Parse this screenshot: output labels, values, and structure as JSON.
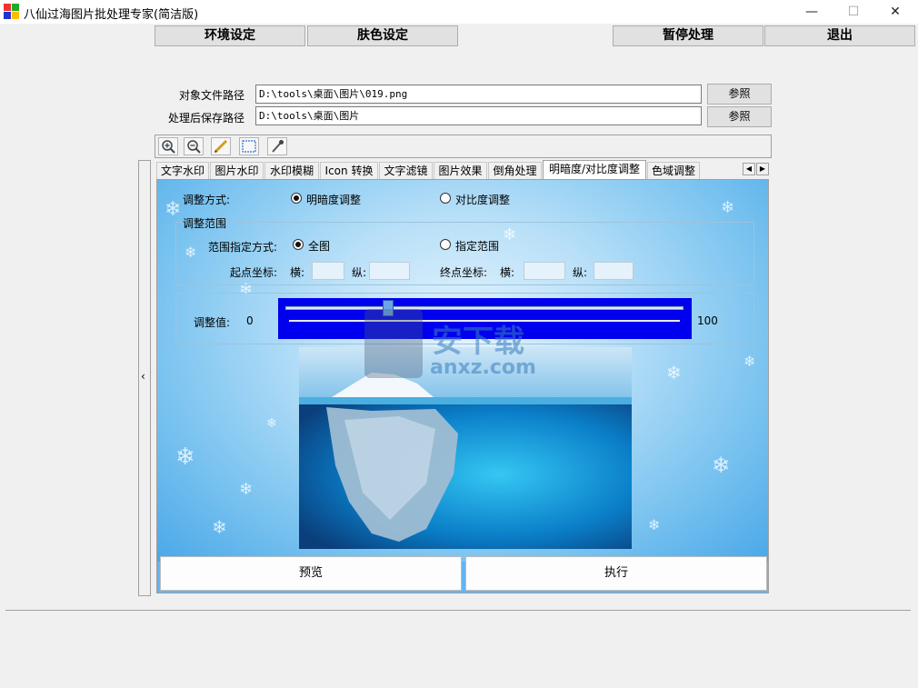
{
  "window": {
    "title": "八仙过海图片批处理专家(简洁版)",
    "minimize": "—",
    "maximize": "☐",
    "close": "✕"
  },
  "toolbar": {
    "env_settings": "环境设定",
    "skin_settings": "肤色设定",
    "pause": "暂停处理",
    "exit": "退出"
  },
  "paths": {
    "source_label": "对象文件路径",
    "source_value": "D:\\tools\\桌面\\图片\\019.png",
    "output_label": "处理后保存路径",
    "output_value": "D:\\tools\\桌面\\图片",
    "browse_label": "参照"
  },
  "tabs": [
    "文字水印",
    "图片水印",
    "水印模糊",
    "Icon 转换",
    "文字滤镜",
    "图片效果",
    "倒角处理",
    "明暗度/对比度调整",
    "色域调整"
  ],
  "active_tab": "明暗度/对比度调整",
  "panel": {
    "mode_label": "调整方式:",
    "mode_brightness": "明暗度调整",
    "mode_contrast": "对比度调整",
    "range_group": "调整范围",
    "range_mode_label": "范围指定方式:",
    "range_all": "全图",
    "range_specified": "指定范围",
    "start_label": "起点坐标:",
    "end_label": "终点坐标:",
    "horiz": "横:",
    "vert": "纵:",
    "adjust_label": "调整值:",
    "slider_min": "0",
    "slider_max": "100",
    "slider_value": 25,
    "preview": "预览",
    "execute": "执行",
    "watermark_text": "安下载",
    "watermark_url": "anxz.com"
  },
  "colors": {
    "slider_bg": "#0000ee",
    "panel_bg": "#5fb6ee"
  }
}
